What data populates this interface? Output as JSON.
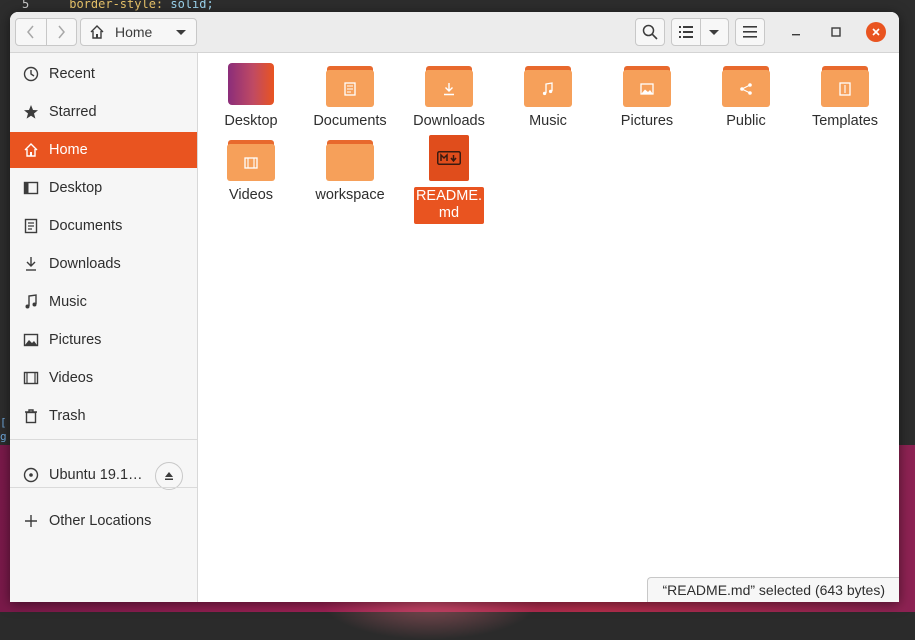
{
  "editor": {
    "line_number": "5",
    "code_property": "border-style:",
    "code_value": " solid;"
  },
  "window": {
    "path_label": "Home",
    "close_color": "#e95420"
  },
  "sidebar": {
    "items": [
      {
        "label": "Recent",
        "icon": "clock-icon"
      },
      {
        "label": "Starred",
        "icon": "star-icon"
      },
      {
        "label": "Home",
        "icon": "home-icon",
        "active": true
      },
      {
        "label": "Desktop",
        "icon": "desktop-icon"
      },
      {
        "label": "Documents",
        "icon": "document-icon"
      },
      {
        "label": "Downloads",
        "icon": "download-icon"
      },
      {
        "label": "Music",
        "icon": "music-icon"
      },
      {
        "label": "Pictures",
        "icon": "picture-icon"
      },
      {
        "label": "Videos",
        "icon": "video-icon"
      },
      {
        "label": "Trash",
        "icon": "trash-icon"
      }
    ],
    "device": {
      "label": "Ubuntu 19.1…",
      "icon": "disc-icon"
    },
    "other_locations": {
      "label": "Other Locations",
      "icon": "plus-icon"
    }
  },
  "files": [
    {
      "name": "Desktop",
      "kind": "desktop-folder"
    },
    {
      "name": "Documents",
      "kind": "documents-folder"
    },
    {
      "name": "Downloads",
      "kind": "downloads-folder"
    },
    {
      "name": "Music",
      "kind": "music-folder"
    },
    {
      "name": "Pictures",
      "kind": "pictures-folder"
    },
    {
      "name": "Public",
      "kind": "public-folder"
    },
    {
      "name": "Templates",
      "kind": "templates-folder"
    },
    {
      "name": "Videos",
      "kind": "videos-folder"
    },
    {
      "name": "workspace",
      "kind": "folder"
    },
    {
      "name": "README.\nmd",
      "kind": "markdown-file",
      "selected": true
    }
  ],
  "status": {
    "text": "“README.md” selected  (643 bytes)"
  },
  "colors": {
    "accent": "#e95420",
    "folder": "#f6a05a",
    "folder_tab": "#e8692d"
  }
}
